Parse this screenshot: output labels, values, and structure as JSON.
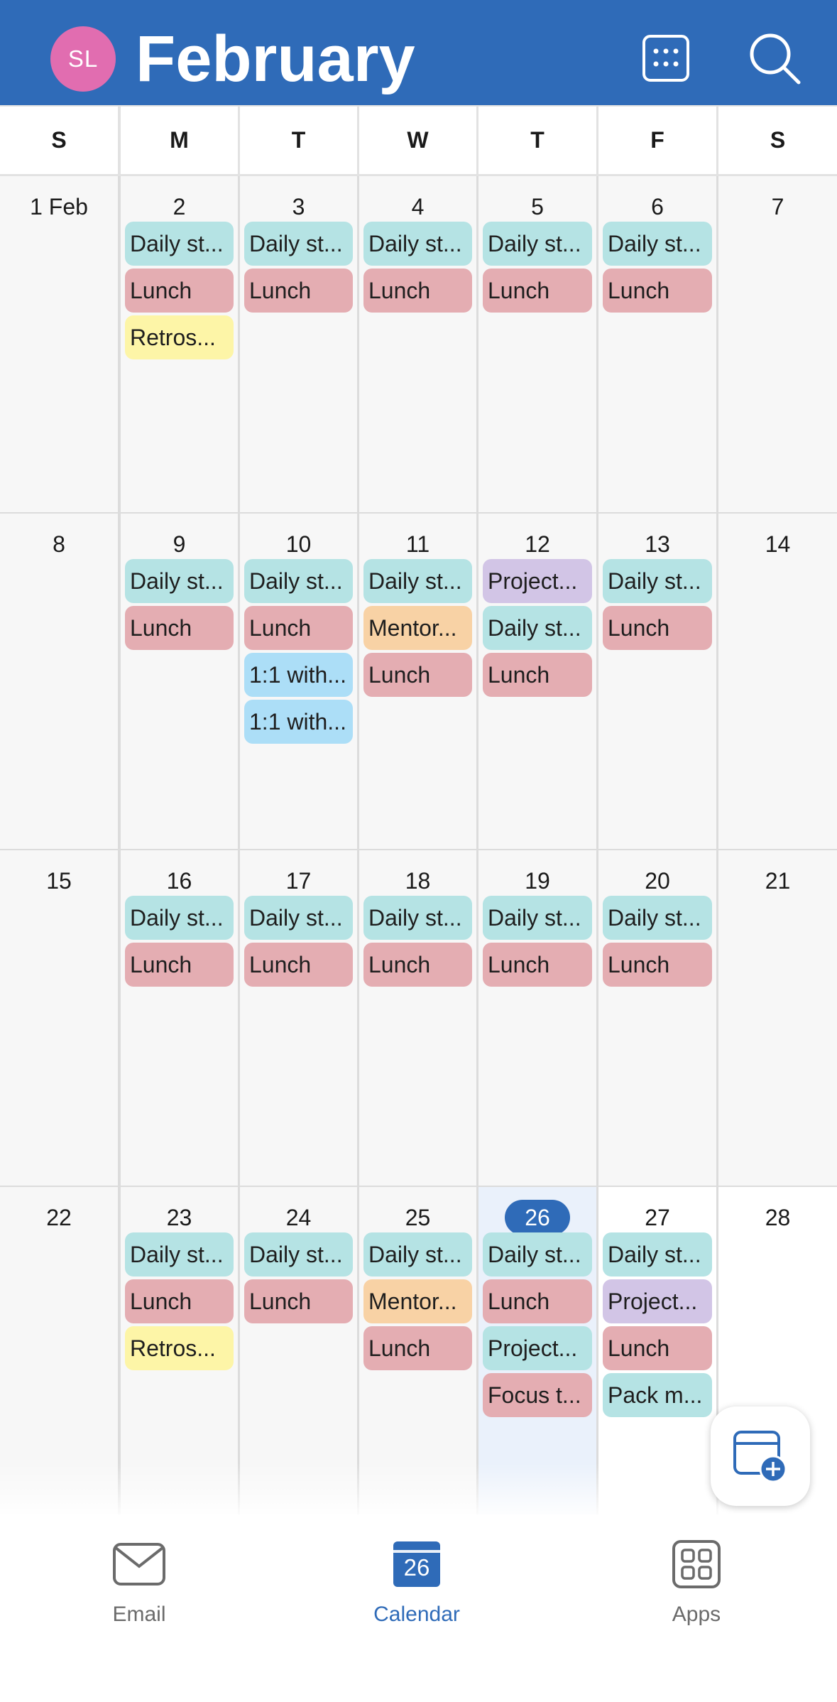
{
  "header": {
    "avatar_initials": "SL",
    "title": "February",
    "grid_icon": "calendar-grid-icon",
    "search_icon": "search-icon"
  },
  "weekdays": [
    "S",
    "M",
    "T",
    "W",
    "T",
    "F",
    "S"
  ],
  "colors": {
    "header": "#2f6bb8",
    "avatar": "#e16db0",
    "teal": "#b5e3e4",
    "pink": "#e4adb2",
    "yellow": "#fdf5a7",
    "purple": "#d2c5e6",
    "orange": "#f8d2a5",
    "blue": "#acdef7"
  },
  "weeks": [
    {
      "days": [
        {
          "label": "1 Feb",
          "events": []
        },
        {
          "label": "2",
          "events": [
            {
              "text": "Daily st...",
              "color": "teal"
            },
            {
              "text": "Lunch",
              "color": "pink"
            },
            {
              "text": "Retros...",
              "color": "yellow"
            }
          ]
        },
        {
          "label": "3",
          "events": [
            {
              "text": "Daily st...",
              "color": "teal"
            },
            {
              "text": "Lunch",
              "color": "pink"
            }
          ]
        },
        {
          "label": "4",
          "events": [
            {
              "text": "Daily st...",
              "color": "teal"
            },
            {
              "text": "Lunch",
              "color": "pink"
            }
          ]
        },
        {
          "label": "5",
          "events": [
            {
              "text": "Daily st...",
              "color": "teal"
            },
            {
              "text": "Lunch",
              "color": "pink"
            }
          ]
        },
        {
          "label": "6",
          "events": [
            {
              "text": "Daily st...",
              "color": "teal"
            },
            {
              "text": "Lunch",
              "color": "pink"
            }
          ]
        },
        {
          "label": "7",
          "events": []
        }
      ]
    },
    {
      "days": [
        {
          "label": "8",
          "events": []
        },
        {
          "label": "9",
          "events": [
            {
              "text": "Daily st...",
              "color": "teal"
            },
            {
              "text": "Lunch",
              "color": "pink"
            }
          ]
        },
        {
          "label": "10",
          "events": [
            {
              "text": "Daily st...",
              "color": "teal"
            },
            {
              "text": "Lunch",
              "color": "pink"
            },
            {
              "text": "1:1 with...",
              "color": "blue"
            },
            {
              "text": "1:1 with...",
              "color": "blue"
            }
          ]
        },
        {
          "label": "11",
          "events": [
            {
              "text": "Daily st...",
              "color": "teal"
            },
            {
              "text": "Mentor...",
              "color": "orange"
            },
            {
              "text": "Lunch",
              "color": "pink"
            }
          ]
        },
        {
          "label": "12",
          "events": [
            {
              "text": "Project...",
              "color": "purple"
            },
            {
              "text": "Daily st...",
              "color": "teal"
            },
            {
              "text": "Lunch",
              "color": "pink"
            }
          ]
        },
        {
          "label": "13",
          "events": [
            {
              "text": "Daily st...",
              "color": "teal"
            },
            {
              "text": "Lunch",
              "color": "pink"
            }
          ]
        },
        {
          "label": "14",
          "events": []
        }
      ]
    },
    {
      "days": [
        {
          "label": "15",
          "events": []
        },
        {
          "label": "16",
          "events": [
            {
              "text": "Daily st...",
              "color": "teal"
            },
            {
              "text": "Lunch",
              "color": "pink"
            }
          ]
        },
        {
          "label": "17",
          "events": [
            {
              "text": "Daily st...",
              "color": "teal"
            },
            {
              "text": "Lunch",
              "color": "pink"
            }
          ]
        },
        {
          "label": "18",
          "events": [
            {
              "text": "Daily st...",
              "color": "teal"
            },
            {
              "text": "Lunch",
              "color": "pink"
            }
          ]
        },
        {
          "label": "19",
          "events": [
            {
              "text": "Daily st...",
              "color": "teal"
            },
            {
              "text": "Lunch",
              "color": "pink"
            }
          ]
        },
        {
          "label": "20",
          "events": [
            {
              "text": "Daily st...",
              "color": "teal"
            },
            {
              "text": "Lunch",
              "color": "pink"
            }
          ]
        },
        {
          "label": "21",
          "events": []
        }
      ]
    },
    {
      "days": [
        {
          "label": "22",
          "events": []
        },
        {
          "label": "23",
          "events": [
            {
              "text": "Daily st...",
              "color": "teal"
            },
            {
              "text": "Lunch",
              "color": "pink"
            },
            {
              "text": "Retros...",
              "color": "yellow"
            }
          ]
        },
        {
          "label": "24",
          "events": [
            {
              "text": "Daily st...",
              "color": "teal"
            },
            {
              "text": "Lunch",
              "color": "pink"
            }
          ]
        },
        {
          "label": "25",
          "events": [
            {
              "text": "Daily st...",
              "color": "teal"
            },
            {
              "text": "Mentor...",
              "color": "orange"
            },
            {
              "text": "Lunch",
              "color": "pink"
            }
          ]
        },
        {
          "label": "26",
          "today": true,
          "events": [
            {
              "text": "Daily st...",
              "color": "teal"
            },
            {
              "text": "Lunch",
              "color": "pink"
            },
            {
              "text": "Project...",
              "color": "teal"
            },
            {
              "text": "Focus t...",
              "color": "pink"
            }
          ]
        },
        {
          "label": "27",
          "events": [
            {
              "text": "Daily st...",
              "color": "teal"
            },
            {
              "text": "Project...",
              "color": "purple"
            },
            {
              "text": "Lunch",
              "color": "pink"
            },
            {
              "text": "Pack m...",
              "color": "teal"
            }
          ]
        },
        {
          "label": "28",
          "events": []
        }
      ]
    }
  ],
  "fab": {
    "icon": "new-event-icon"
  },
  "bottom_nav": [
    {
      "label": "Email",
      "icon": "mail-icon",
      "active": false
    },
    {
      "label": "Calendar",
      "icon": "calendar-icon",
      "icon_text": "26",
      "active": true
    },
    {
      "label": "Apps",
      "icon": "apps-grid-icon",
      "active": false
    }
  ]
}
